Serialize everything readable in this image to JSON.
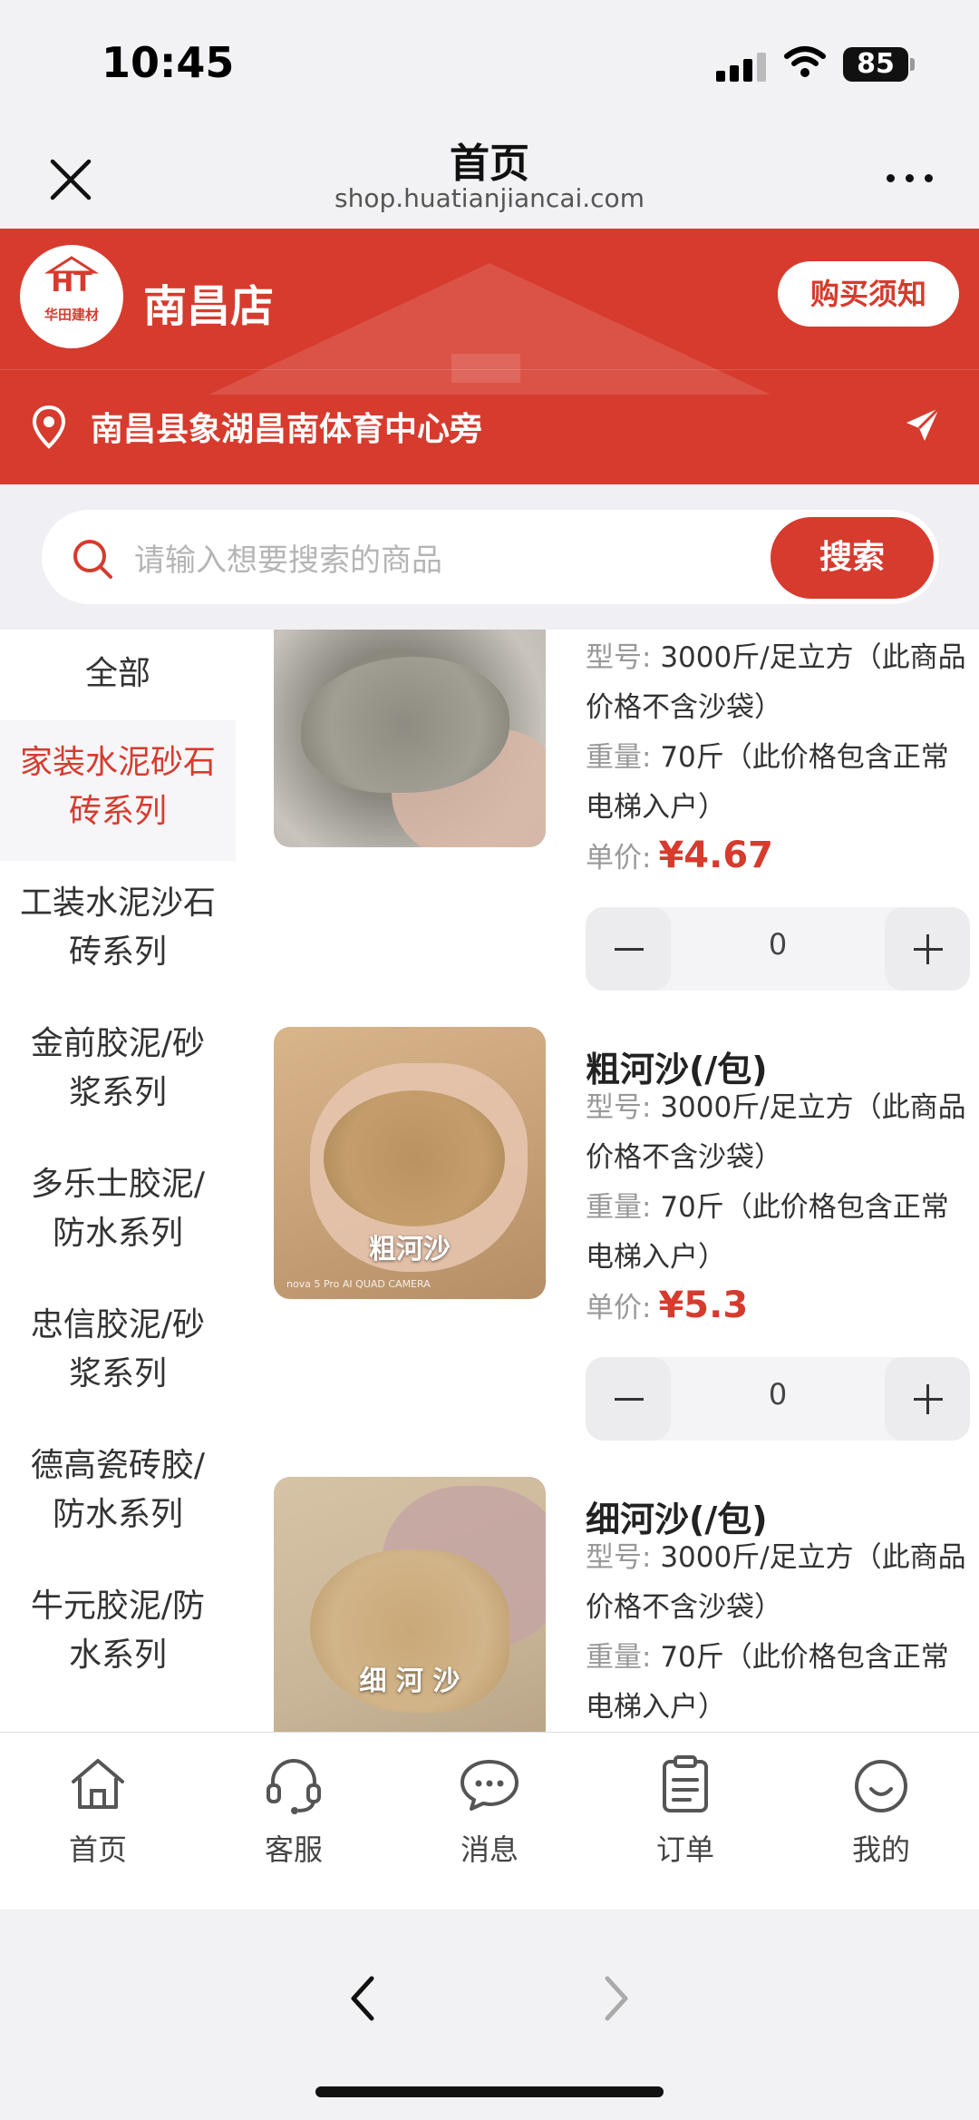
{
  "status_bar": {
    "time": "10:45",
    "battery": "85"
  },
  "nav": {
    "title": "首页",
    "url": "shop.huatianjiancai.com"
  },
  "shop": {
    "logo_text": "HT",
    "logo_sub": "华田建材",
    "name": "南昌店",
    "notice_button": "购买须知",
    "address": "南昌县象湖昌南体育中心旁"
  },
  "search": {
    "placeholder": "请输入想要搜索的商品",
    "button": "搜索"
  },
  "categories": [
    {
      "label_line1": "全部",
      "label_line2": "",
      "active": false
    },
    {
      "label_line1": "家装水泥砂石",
      "label_line2": "砖系列",
      "active": true
    },
    {
      "label_line1": "工装水泥沙石",
      "label_line2": "砖系列",
      "active": false
    },
    {
      "label_line1": "金前胶泥/砂",
      "label_line2": "浆系列",
      "active": false
    },
    {
      "label_line1": "多乐士胶泥/",
      "label_line2": "防水系列",
      "active": false
    },
    {
      "label_line1": "忠信胶泥/砂",
      "label_line2": "浆系列",
      "active": false
    },
    {
      "label_line1": "德高瓷砖胶/",
      "label_line2": "防水系列",
      "active": false
    },
    {
      "label_line1": "牛元胶泥/防",
      "label_line2": "水系列",
      "active": false
    }
  ],
  "products": [
    {
      "name": "",
      "model_key": "型号:",
      "model_value": "3000斤/足立方（此商品价格不含沙袋）",
      "weight_key": "重量:",
      "weight_value": "70斤（此价格包含正常电梯入户）",
      "price_key": "单价:",
      "price": "¥4.67",
      "qty": "0",
      "image_caption": ""
    },
    {
      "name": "粗河沙(/包)",
      "model_key": "型号:",
      "model_value": "3000斤/足立方（此商品价格不含沙袋）",
      "weight_key": "重量:",
      "weight_value": "70斤（此价格包含正常电梯入户）",
      "price_key": "单价:",
      "price": "¥5.3",
      "qty": "0",
      "image_caption": "粗河沙",
      "image_watermark": "nova 5 Pro AI QUAD CAMERA"
    },
    {
      "name": "细河沙(/包)",
      "model_key": "型号:",
      "model_value": "3000斤/足立方（此商品价格不含沙袋）",
      "weight_key": "重量:",
      "weight_value": "70斤（此价格包含正常电梯入户）",
      "image_caption": "细 河 沙"
    }
  ],
  "tabs": [
    {
      "label": "首页",
      "icon": "home-icon"
    },
    {
      "label": "客服",
      "icon": "headset-icon"
    },
    {
      "label": "消息",
      "icon": "message-icon"
    },
    {
      "label": "订单",
      "icon": "clipboard-icon"
    },
    {
      "label": "我的",
      "icon": "smile-icon"
    }
  ],
  "colors": {
    "brand_red": "#d63b2e",
    "background": "#efeff4"
  }
}
